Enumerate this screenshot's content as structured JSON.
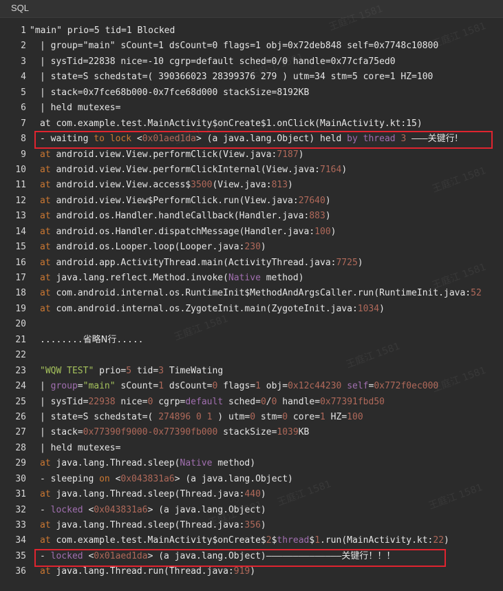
{
  "header": {
    "label": "SQL"
  },
  "watermark": "王庭江 1581",
  "lines": [
    {
      "n": "1",
      "indent": "",
      "seg": [
        [
          "d",
          "\"main\" prio=5 tid=1 Blocked"
        ]
      ]
    },
    {
      "n": "2",
      "indent": "  ",
      "seg": [
        [
          "d",
          "| group=\"main\" sCount=1 dsCount=0 flags=1 obj=0x72deb848 self=0x7748c10800"
        ]
      ]
    },
    {
      "n": "3",
      "indent": "  ",
      "seg": [
        [
          "d",
          "| sysTid=22838 nice=-10 cgrp=default sched=0/0 handle=0x77cfa75ed0"
        ]
      ]
    },
    {
      "n": "4",
      "indent": "  ",
      "seg": [
        [
          "d",
          "| state=S schedstat=( 390366023 28399376 279 ) utm=34 stm=5 core=1 HZ=100"
        ]
      ]
    },
    {
      "n": "5",
      "indent": "  ",
      "seg": [
        [
          "d",
          "| stack=0x7fce68b000-0x7fce68d000 stackSize=8192KB"
        ]
      ]
    },
    {
      "n": "6",
      "indent": "  ",
      "seg": [
        [
          "d",
          "| held mutexes="
        ]
      ]
    },
    {
      "n": "7",
      "indent": "  ",
      "seg": [
        [
          "d",
          "at com.example.test.MainActivity$onCreate$1.onClick(MainActivity.kt:15)"
        ]
      ]
    },
    {
      "n": "8",
      "indent": "  ",
      "seg": [
        [
          "d",
          "- waiting "
        ],
        [
          "k",
          "to"
        ],
        [
          "d",
          " "
        ],
        [
          "k",
          "lock"
        ],
        [
          "d",
          " <"
        ],
        [
          "n",
          "0x01aed1da"
        ],
        [
          "d",
          "> (a java.lang.Object) held "
        ],
        [
          "p",
          "by"
        ],
        [
          "d",
          " "
        ],
        [
          "p",
          "thread"
        ],
        [
          "d",
          " "
        ],
        [
          "n",
          "3"
        ],
        [
          "d",
          " ———"
        ],
        [
          "cn",
          "关键行!"
        ]
      ]
    },
    {
      "n": "9",
      "indent": "  ",
      "seg": [
        [
          "k",
          "at"
        ],
        [
          "d",
          " android.view.View.performClick(View.java:"
        ],
        [
          "n",
          "7187"
        ],
        [
          "d",
          ")"
        ]
      ]
    },
    {
      "n": "10",
      "indent": "  ",
      "seg": [
        [
          "k",
          "at"
        ],
        [
          "d",
          " android.view.View.performClickInternal(View.java:"
        ],
        [
          "n",
          "7164"
        ],
        [
          "d",
          ")"
        ]
      ]
    },
    {
      "n": "11",
      "indent": "  ",
      "seg": [
        [
          "k",
          "at"
        ],
        [
          "d",
          " android.view.View.access$"
        ],
        [
          "n",
          "3500"
        ],
        [
          "d",
          "(View.java:"
        ],
        [
          "n",
          "813"
        ],
        [
          "d",
          ")"
        ]
      ]
    },
    {
      "n": "12",
      "indent": "  ",
      "seg": [
        [
          "k",
          "at"
        ],
        [
          "d",
          " android.view.View$PerformClick.run(View.java:"
        ],
        [
          "n",
          "27640"
        ],
        [
          "d",
          ")"
        ]
      ]
    },
    {
      "n": "13",
      "indent": "  ",
      "seg": [
        [
          "k",
          "at"
        ],
        [
          "d",
          " android.os.Handler.handleCallback(Handler.java:"
        ],
        [
          "n",
          "883"
        ],
        [
          "d",
          ")"
        ]
      ]
    },
    {
      "n": "14",
      "indent": "  ",
      "seg": [
        [
          "k",
          "at"
        ],
        [
          "d",
          " android.os.Handler.dispatchMessage(Handler.java:"
        ],
        [
          "n",
          "100"
        ],
        [
          "d",
          ")"
        ]
      ]
    },
    {
      "n": "15",
      "indent": "  ",
      "seg": [
        [
          "k",
          "at"
        ],
        [
          "d",
          " android.os.Looper.loop(Looper.java:"
        ],
        [
          "n",
          "230"
        ],
        [
          "d",
          ")"
        ]
      ]
    },
    {
      "n": "16",
      "indent": "  ",
      "seg": [
        [
          "k",
          "at"
        ],
        [
          "d",
          " android.app.ActivityThread.main(ActivityThread.java:"
        ],
        [
          "n",
          "7725"
        ],
        [
          "d",
          ")"
        ]
      ]
    },
    {
      "n": "17",
      "indent": "  ",
      "seg": [
        [
          "k",
          "at"
        ],
        [
          "d",
          " java.lang.reflect.Method.invoke("
        ],
        [
          "p",
          "Native"
        ],
        [
          "d",
          " method)"
        ]
      ]
    },
    {
      "n": "18",
      "indent": "  ",
      "seg": [
        [
          "k",
          "at"
        ],
        [
          "d",
          " com.android.internal.os.RuntimeInit$MethodAndArgsCaller.run(RuntimeInit.java:"
        ],
        [
          "n",
          "52"
        ]
      ]
    },
    {
      "n": "19",
      "indent": "  ",
      "seg": [
        [
          "k",
          "at"
        ],
        [
          "d",
          " com.android.internal.os.ZygoteInit.main(ZygoteInit.java:"
        ],
        [
          "n",
          "1034"
        ],
        [
          "d",
          ")"
        ]
      ]
    },
    {
      "n": "20",
      "indent": "",
      "seg": []
    },
    {
      "n": "21",
      "indent": "  ",
      "seg": [
        [
          "d",
          "........"
        ],
        [
          "cn",
          "省略N行"
        ],
        [
          "d",
          "....."
        ]
      ]
    },
    {
      "n": "22",
      "indent": "",
      "seg": []
    },
    {
      "n": "23",
      "indent": "  ",
      "seg": [
        [
          "s",
          "\"WQW TEST\""
        ],
        [
          "d",
          " prio="
        ],
        [
          "n",
          "5"
        ],
        [
          "d",
          " tid="
        ],
        [
          "n",
          "3"
        ],
        [
          "d",
          " TimeWating"
        ]
      ]
    },
    {
      "n": "24",
      "indent": "  ",
      "seg": [
        [
          "d",
          "| "
        ],
        [
          "p",
          "group"
        ],
        [
          "d",
          "="
        ],
        [
          "s",
          "\"main\""
        ],
        [
          "d",
          " sCount="
        ],
        [
          "n",
          "1"
        ],
        [
          "d",
          " dsCount="
        ],
        [
          "n",
          "0"
        ],
        [
          "d",
          " flags="
        ],
        [
          "n",
          "1"
        ],
        [
          "d",
          " obj="
        ],
        [
          "n",
          "0x12c44230"
        ],
        [
          "d",
          " "
        ],
        [
          "p",
          "self"
        ],
        [
          "d",
          "="
        ],
        [
          "n",
          "0x772f0ec000"
        ]
      ]
    },
    {
      "n": "25",
      "indent": "  ",
      "seg": [
        [
          "d",
          "| sysTid="
        ],
        [
          "n",
          "22938"
        ],
        [
          "d",
          " nice="
        ],
        [
          "n",
          "0"
        ],
        [
          "d",
          " cgrp="
        ],
        [
          "p",
          "default"
        ],
        [
          "d",
          " sched="
        ],
        [
          "n",
          "0"
        ],
        [
          "d",
          "/"
        ],
        [
          "n",
          "0"
        ],
        [
          "d",
          " handle="
        ],
        [
          "n",
          "0x77391fbd50"
        ]
      ]
    },
    {
      "n": "26",
      "indent": "  ",
      "seg": [
        [
          "d",
          "| state=S schedstat=( "
        ],
        [
          "n",
          "274896 0 1"
        ],
        [
          "d",
          " ) utm="
        ],
        [
          "n",
          "0"
        ],
        [
          "d",
          " stm="
        ],
        [
          "n",
          "0"
        ],
        [
          "d",
          " core="
        ],
        [
          "n",
          "1"
        ],
        [
          "d",
          " HZ="
        ],
        [
          "n",
          "100"
        ]
      ]
    },
    {
      "n": "27",
      "indent": "  ",
      "seg": [
        [
          "d",
          "| stack="
        ],
        [
          "n",
          "0x77390f9000-0x77390fb000"
        ],
        [
          "d",
          " stackSize="
        ],
        [
          "n",
          "1039"
        ],
        [
          "d",
          "KB"
        ]
      ]
    },
    {
      "n": "28",
      "indent": "  ",
      "seg": [
        [
          "d",
          "| held mutexes="
        ]
      ]
    },
    {
      "n": "29",
      "indent": "  ",
      "seg": [
        [
          "k",
          "at"
        ],
        [
          "d",
          " java.lang.Thread.sleep("
        ],
        [
          "p",
          "Native"
        ],
        [
          "d",
          " method)"
        ]
      ]
    },
    {
      "n": "30",
      "indent": "  ",
      "seg": [
        [
          "d",
          "- sleeping "
        ],
        [
          "k",
          "on"
        ],
        [
          "d",
          " <"
        ],
        [
          "n",
          "0x043831a6"
        ],
        [
          "d",
          "> (a java.lang.Object)"
        ]
      ]
    },
    {
      "n": "31",
      "indent": "  ",
      "seg": [
        [
          "k",
          "at"
        ],
        [
          "d",
          " java.lang.Thread.sleep(Thread.java:"
        ],
        [
          "n",
          "440"
        ],
        [
          "d",
          ")"
        ]
      ]
    },
    {
      "n": "32",
      "indent": "  ",
      "seg": [
        [
          "d",
          "- "
        ],
        [
          "p",
          "locked"
        ],
        [
          "d",
          " <"
        ],
        [
          "n",
          "0x043831a6"
        ],
        [
          "d",
          "> (a java.lang.Object)"
        ]
      ]
    },
    {
      "n": "33",
      "indent": "  ",
      "seg": [
        [
          "k",
          "at"
        ],
        [
          "d",
          " java.lang.Thread.sleep(Thread.java:"
        ],
        [
          "n",
          "356"
        ],
        [
          "d",
          ")"
        ]
      ]
    },
    {
      "n": "34",
      "indent": "  ",
      "seg": [
        [
          "k",
          "at"
        ],
        [
          "d",
          " com.example.test.MainActivity$onCreate$"
        ],
        [
          "n",
          "2"
        ],
        [
          "d",
          "$"
        ],
        [
          "p",
          "thread"
        ],
        [
          "d",
          "$"
        ],
        [
          "n",
          "1"
        ],
        [
          "d",
          ".run(MainActivity.kt:"
        ],
        [
          "n",
          "22"
        ],
        [
          "d",
          ")"
        ]
      ]
    },
    {
      "n": "35",
      "indent": "  ",
      "seg": [
        [
          "d",
          "- "
        ],
        [
          "p",
          "locked"
        ],
        [
          "d",
          " <"
        ],
        [
          "n",
          "0x01aed1da"
        ],
        [
          "d",
          "> (a java.lang.Object)——————————————"
        ],
        [
          "cn",
          "关键行！！！"
        ]
      ]
    },
    {
      "n": "36",
      "indent": "  ",
      "seg": [
        [
          "k",
          "at"
        ],
        [
          "d",
          " java.lang.Thread.run(Thread.java:"
        ],
        [
          "n",
          "919"
        ],
        [
          "d",
          ")"
        ]
      ]
    }
  ]
}
